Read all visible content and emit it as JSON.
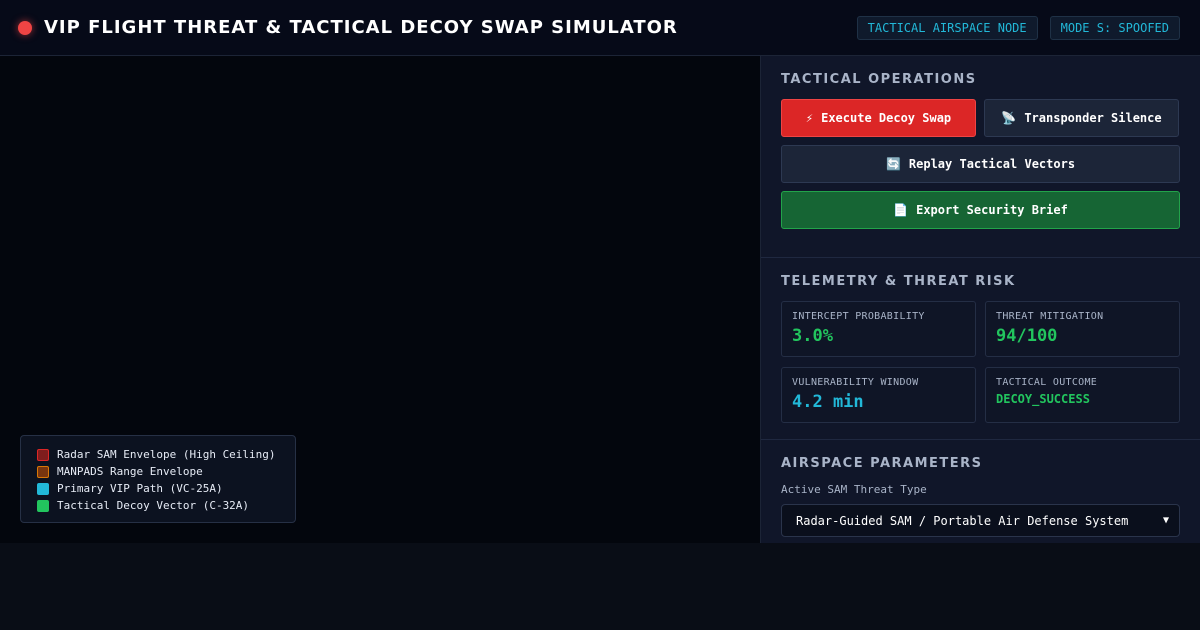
{
  "header": {
    "title": "VIP FLIGHT THREAT & TACTICAL DECOY SWAP SIMULATOR",
    "badges": [
      "TACTICAL AIRSPACE NODE",
      "MODE S: SPOOFED"
    ]
  },
  "legend": {
    "items": [
      {
        "label": "Radar SAM Envelope (High Ceiling)",
        "color": "#dc2626"
      },
      {
        "label": "MANPADS Range Envelope",
        "color": "#d97706"
      },
      {
        "label": "Primary VIP Path (VC-25A)",
        "color": "#22b8d8"
      },
      {
        "label": "Tactical Decoy Vector (C-32A)",
        "color": "#22c55e"
      }
    ]
  },
  "operations": {
    "title": "TACTICAL OPERATIONS",
    "execute_label": "Execute Decoy Swap",
    "execute_icon": "⚡",
    "silence_label": "Transponder Silence",
    "silence_icon": "📡",
    "replay_label": "Replay Tactical Vectors",
    "replay_icon": "🔄",
    "export_label": "Export Security Brief",
    "export_icon": "📄"
  },
  "telemetry": {
    "title": "TELEMETRY & THREAT RISK",
    "metrics": [
      {
        "label": "INTERCEPT PROBABILITY",
        "value": "3.0%"
      },
      {
        "label": "THREAT MITIGATION",
        "value": "94/100"
      },
      {
        "label": "VULNERABILITY WINDOW",
        "value": "4.2 min"
      },
      {
        "label": "TACTICAL OUTCOME",
        "value": "DECOY_SUCCESS"
      }
    ]
  },
  "airspace": {
    "title": "AIRSPACE PARAMETERS",
    "threat_label": "Active SAM Threat Type",
    "threat_value": "Radar-Guided SAM / Portable Air Defense System"
  },
  "colors": {
    "accent_cyan": "#22b8d8",
    "success_green": "#22c55e",
    "danger_red": "#dc2626"
  }
}
